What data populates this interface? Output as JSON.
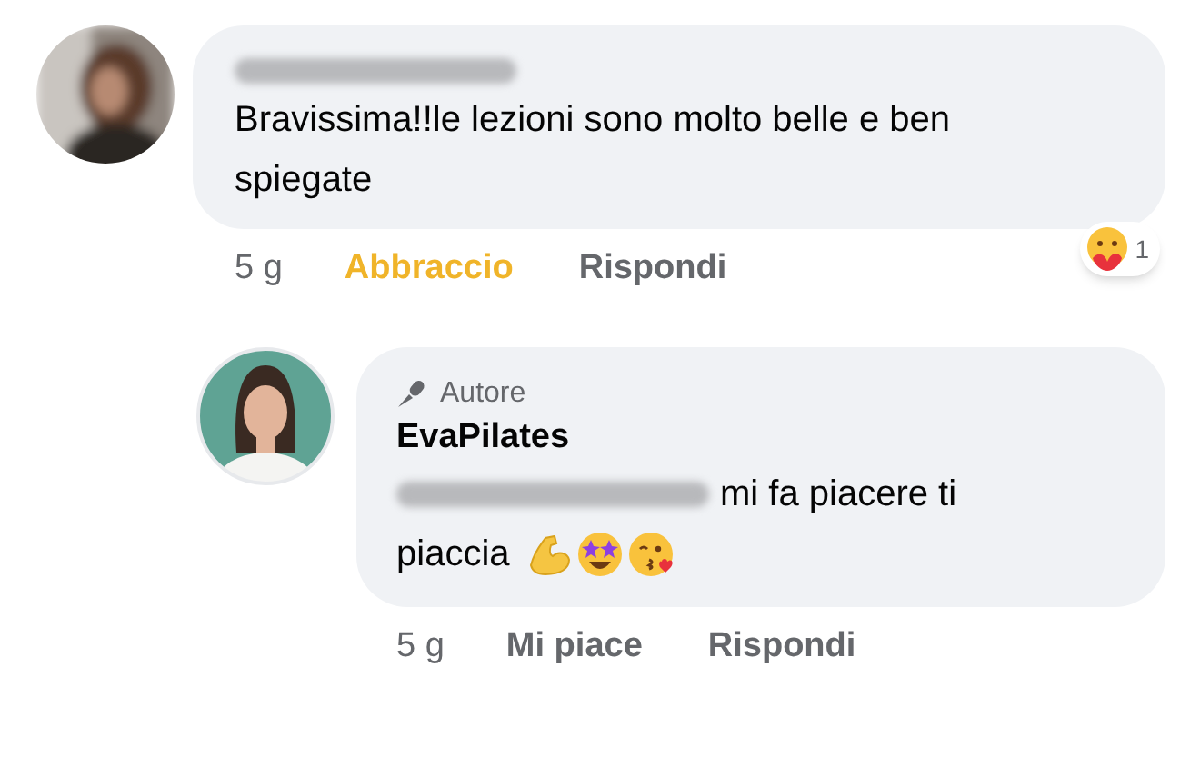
{
  "comment": {
    "name_hidden": true,
    "text": "Bravissima!!le lezioni sono molto belle e ben spiegate",
    "time": "5 g",
    "reaction_label": "Abbraccio",
    "reaction_selected": true,
    "reply_label": "Rispondi",
    "reaction_count": "1"
  },
  "reply": {
    "badge": "Autore",
    "author": "EvaPilates",
    "mention_hidden": true,
    "text_lines": [
      "mi fa piacere ti",
      "piaccia"
    ],
    "emojis": [
      {
        "kind": "muscle"
      },
      {
        "kind": "star-eyes"
      },
      {
        "kind": "kiss"
      }
    ],
    "time": "5 g",
    "reaction_label": "Mi piace",
    "reaction_selected": false,
    "reply_label": "Rispondi"
  }
}
